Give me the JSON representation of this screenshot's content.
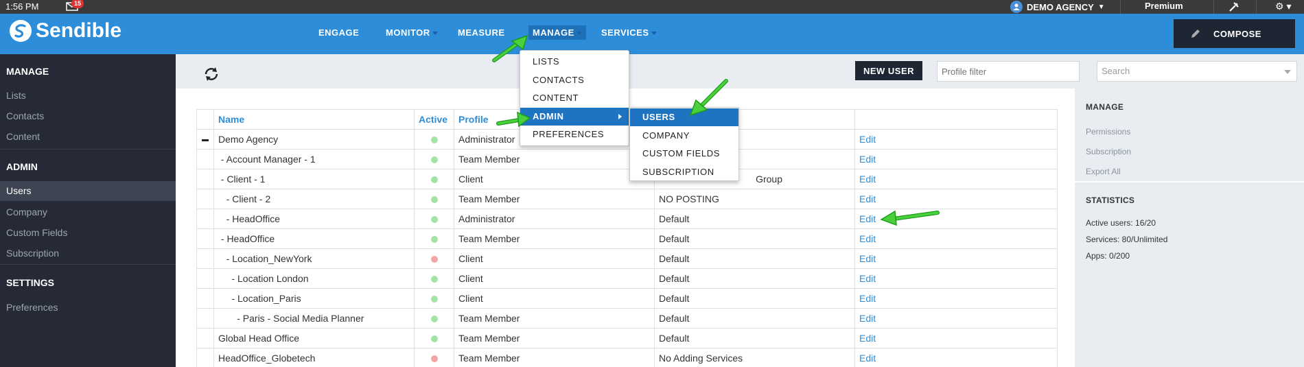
{
  "status_bar": {
    "time": "1:56 PM",
    "mail_count": "15",
    "account": "DEMO AGENCY",
    "plan": "Premium"
  },
  "nav": {
    "logo": "Sendible",
    "engage": "ENGAGE",
    "monitor": "MONITOR",
    "measure": "MEASURE",
    "manage": "MANAGE",
    "services": "SERVICES",
    "compose": "COMPOSE"
  },
  "sidebar": {
    "manage_head": "MANAGE",
    "lists": "Lists",
    "contacts": "Contacts",
    "content": "Content",
    "admin_head": "ADMIN",
    "users": "Users",
    "company": "Company",
    "custom_fields": "Custom Fields",
    "subscription": "Subscription",
    "settings_head": "SETTINGS",
    "preferences": "Preferences"
  },
  "toolbar": {
    "new_user": "NEW USER",
    "profile_filter_placeholder": "Profile filter",
    "search_placeholder": "Search"
  },
  "manage_menu": {
    "items": [
      "LISTS",
      "CONTACTS",
      "CONTENT",
      "ADMIN",
      "PREFERENCES"
    ]
  },
  "admin_submenu": {
    "items": [
      "USERS",
      "COMPANY",
      "CUSTOM FIELDS",
      "SUBSCRIPTION"
    ]
  },
  "table": {
    "headers": {
      "name": "Name",
      "active": "Active",
      "profile": "Profile"
    },
    "edit_label": "Edit",
    "rows": [
      {
        "name": "Demo Agency",
        "active": true,
        "profile": "Administrator",
        "group": ""
      },
      {
        "name": " - Account Manager - 1",
        "active": true,
        "profile": "Team Member",
        "group": ""
      },
      {
        "name": " - Client - 1",
        "active": true,
        "profile": "Client",
        "group": "Group"
      },
      {
        "name": "   - Client - 2",
        "active": true,
        "profile": "Team Member",
        "group": "NO POSTING"
      },
      {
        "name": "   - HeadOffice",
        "active": true,
        "profile": "Administrator",
        "group": "Default"
      },
      {
        "name": " - HeadOffice",
        "active": true,
        "profile": "Team Member",
        "group": "Default"
      },
      {
        "name": "   - Location_NewYork",
        "active": false,
        "profile": "Client",
        "group": "Default"
      },
      {
        "name": "     - Location London",
        "active": true,
        "profile": "Client",
        "group": "Default"
      },
      {
        "name": "     - Location_Paris",
        "active": true,
        "profile": "Client",
        "group": "Default"
      },
      {
        "name": "       - Paris - Social Media Planner",
        "active": true,
        "profile": "Team Member",
        "group": "Default"
      },
      {
        "name": "Global Head Office",
        "active": true,
        "profile": "Team Member",
        "group": "Default"
      },
      {
        "name": "HeadOffice_Globetech",
        "active": false,
        "profile": "Team Member",
        "group": "No Adding Services"
      }
    ]
  },
  "right_panel": {
    "manage_head": "MANAGE",
    "permissions": "Permissions",
    "subscription": "Subscription",
    "export_all": "Export All",
    "stats_head": "STATISTICS",
    "active_users": "Active users: 16/20",
    "services": "Services: 80/Unlimited",
    "apps": "Apps: 0/200"
  }
}
